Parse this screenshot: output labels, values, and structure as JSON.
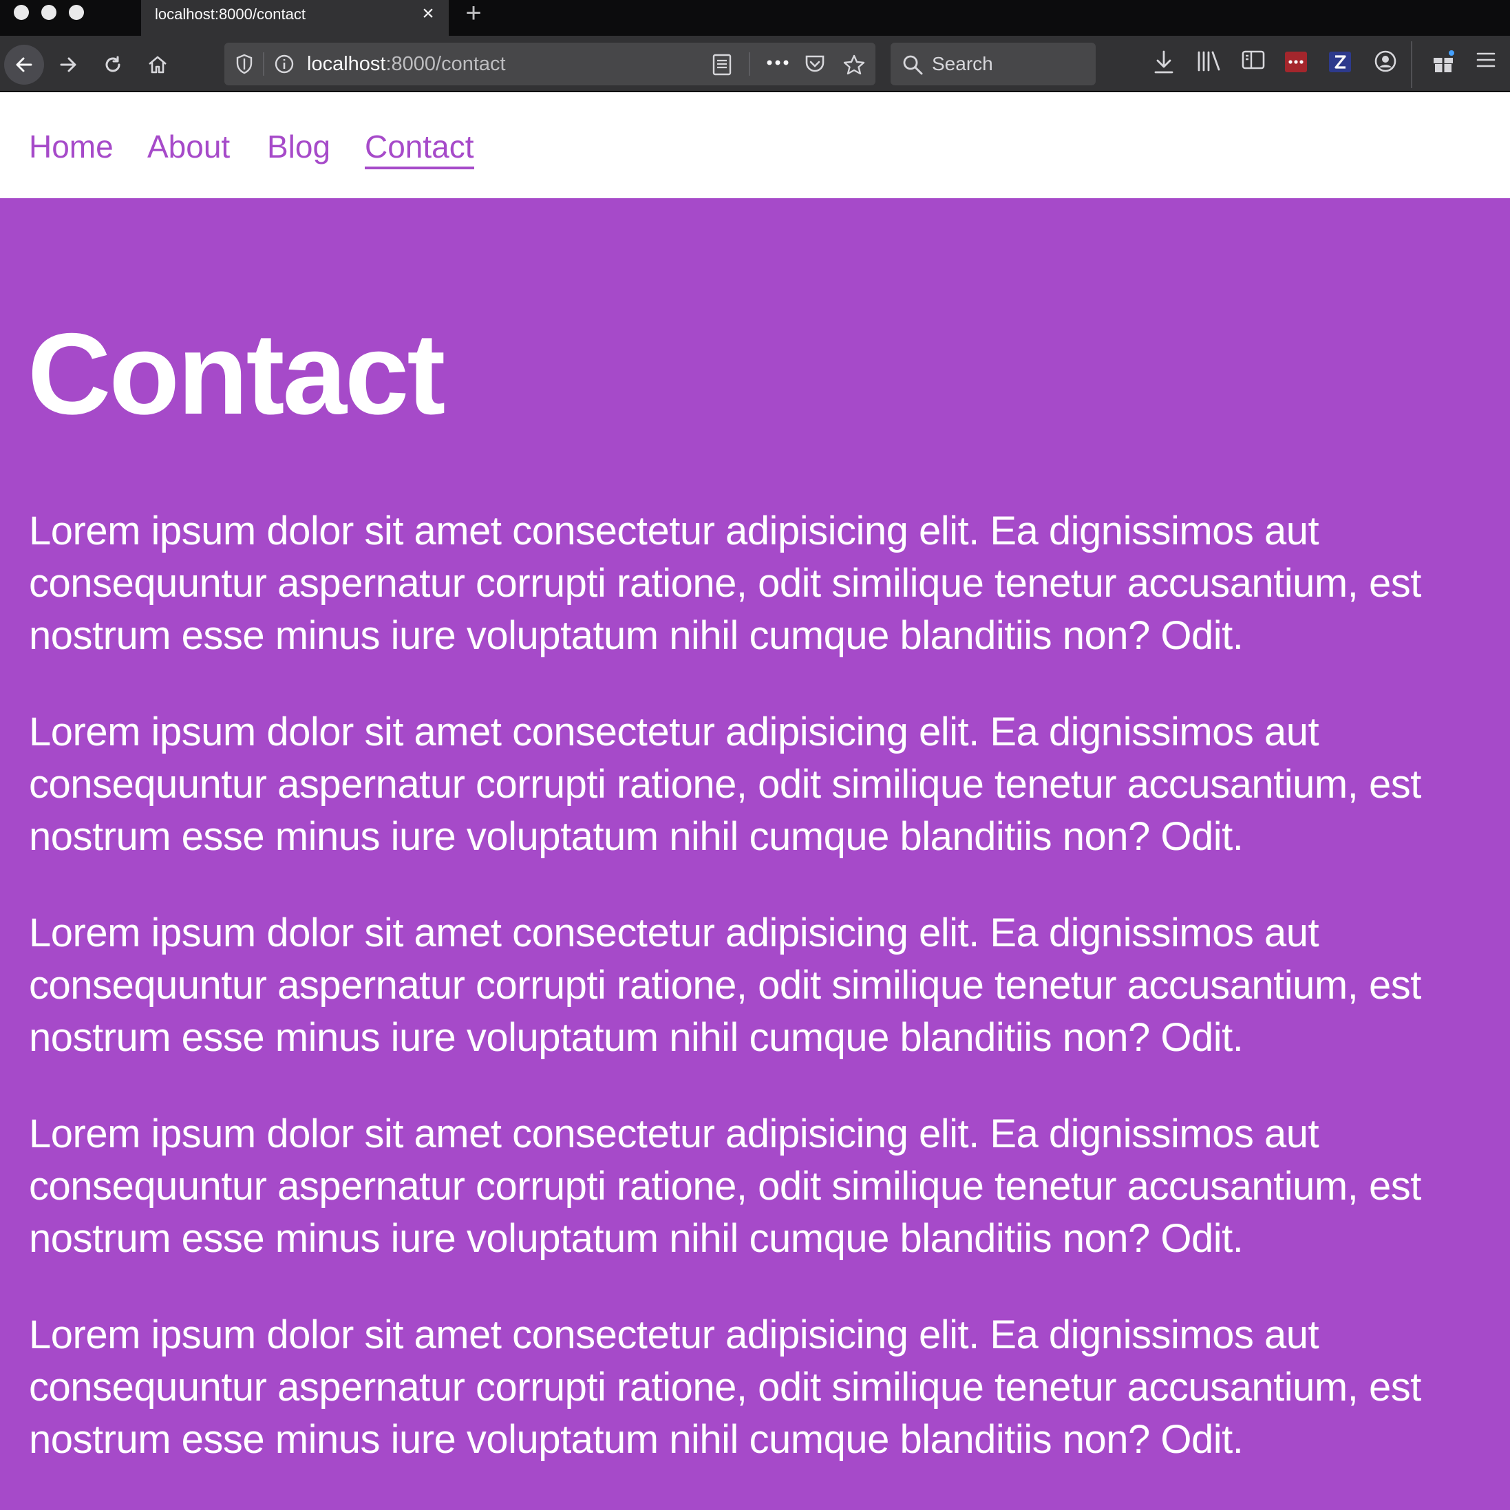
{
  "browser": {
    "tab_title": "localhost:8000/contact",
    "url_host": "localhost",
    "url_path": ":8000/contact",
    "search_placeholder": "Search"
  },
  "nav": {
    "items": [
      {
        "label": "Home"
      },
      {
        "label": "About"
      },
      {
        "label": "Blog"
      },
      {
        "label": "Contact"
      }
    ],
    "active": "Contact"
  },
  "main": {
    "title": "Contact",
    "paragraphs": [
      "Lorem ipsum dolor sit amet consectetur adipisicing elit. Ea dignissimos aut consequuntur aspernatur corrupti ratione, odit similique tenetur accusantium, est nostrum esse minus iure voluptatum nihil cumque blanditiis non? Odit.",
      "Lorem ipsum dolor sit amet consectetur adipisicing elit. Ea dignissimos aut consequuntur aspernatur corrupti ratione, odit similique tenetur accusantium, est nostrum esse minus iure voluptatum nihil cumque blanditiis non? Odit.",
      "Lorem ipsum dolor sit amet consectetur adipisicing elit. Ea dignissimos aut consequuntur aspernatur corrupti ratione, odit similique tenetur accusantium, est nostrum esse minus iure voluptatum nihil cumque blanditiis non? Odit.",
      "Lorem ipsum dolor sit amet consectetur adipisicing elit. Ea dignissimos aut consequuntur aspernatur corrupti ratione, odit similique tenetur accusantium, est nostrum esse minus iure voluptatum nihil cumque blanditiis non? Odit.",
      "Lorem ipsum dolor sit amet consectetur adipisicing elit. Ea dignissimos aut consequuntur aspernatur corrupti ratione, odit similique tenetur accusantium, est nostrum esse minus iure voluptatum nihil cumque blanditiis non? Odit."
    ]
  },
  "colors": {
    "accent": "#a64ac9",
    "chrome_dark": "#0c0c0d",
    "chrome_toolbar": "#323234",
    "text_on_accent": "#ffffff"
  },
  "icons": {
    "toolbar": [
      "back-icon",
      "forward-icon",
      "reload-icon",
      "home-icon",
      "tracking-shield-icon",
      "site-info-icon",
      "reader-view-icon",
      "page-actions-icon",
      "pocket-icon",
      "bookmark-star-icon",
      "search-icon",
      "downloads-icon",
      "library-icon",
      "sidebar-icon",
      "extension-lastpass-icon",
      "extension-zotero-icon",
      "account-icon",
      "gift-icon",
      "hamburger-menu-icon"
    ]
  }
}
